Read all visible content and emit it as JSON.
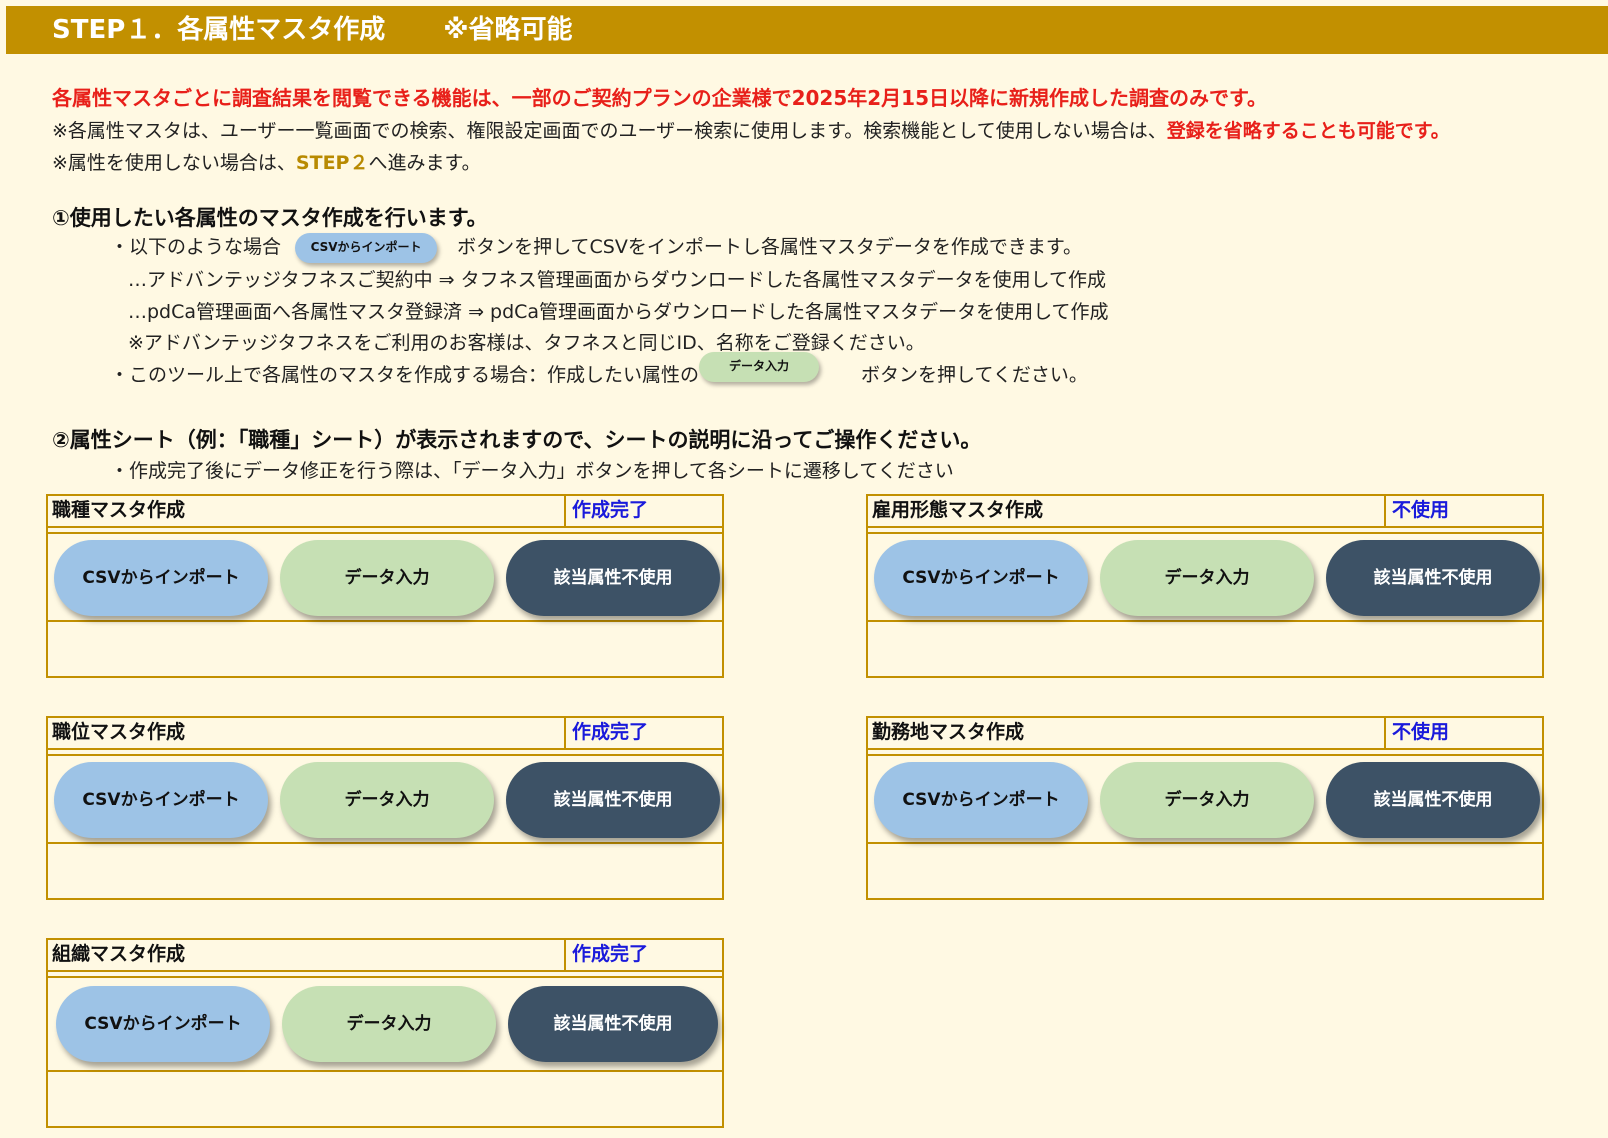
{
  "header": {
    "title": "STEP１．各属性マスタ作成",
    "note": "※省略可能"
  },
  "notice": {
    "warning": "各属性マスタごとに調査結果を閲覧できる機能は、一部のご契約プランの企業様で2025年2月15日以降に新規作成した調査のみです。",
    "line2_prefix": "※各属性マスタは、ユーザー一覧画面での検索、権限設定画面でのユーザー検索に使用します。検索機能として使用しない場合は、",
    "line2_red": "登録を省略することも可能です。",
    "line3_prefix": "※属性を使用しない場合は、",
    "line3_link": "STEP２",
    "line3_suffix": "へ進みます。"
  },
  "section1": {
    "heading": "①使用したい各属性のマスタ作成を行います。",
    "bullet1_prefix": "・以下のような場合",
    "bullet1_button": "CSVからインポート",
    "bullet1_suffix": "ボタンを押してCSVをインポートし各属性マスタデータを作成できます。",
    "sub1": "…アドバンテッジタフネスご契約中 ⇒ タフネス管理画面からダウンロードした各属性マスタデータを使用して作成",
    "sub2": "…pdCa管理画面へ各属性マスタ登録済 ⇒ pdCa管理画面からダウンロードした各属性マスタデータを使用して作成",
    "sub3": "※アドバンテッジタフネスをご利用のお客様は、タフネスと同じID、名称をご登録ください。",
    "bullet2_prefix": "・このツール上で各属性のマスタを作成する場合：作成したい属性の",
    "bullet2_button": "データ入力",
    "bullet2_suffix": "ボタンを押してください。"
  },
  "section2": {
    "heading": "②属性シート（例：「職種」シート）が表示されますので、シートの説明に沿ってご操作ください。",
    "bullet": "・作成完了後にデータ修正を行う際は、「データ入力」ボタンを押して各シートに遷移してください"
  },
  "buttons": {
    "csv": "CSVからインポート",
    "data": "データ入力",
    "unused": "該当属性不使用"
  },
  "panels": [
    {
      "title": "職種マスタ作成",
      "status": "作成完了"
    },
    {
      "title": "雇用形態マスタ作成",
      "status": "不使用"
    },
    {
      "title": "職位マスタ作成",
      "status": "作成完了"
    },
    {
      "title": "勤務地マスタ作成",
      "status": "不使用"
    },
    {
      "title": "組織マスタ作成",
      "status": "作成完了"
    }
  ],
  "colors": {
    "header_bg": "#c29000",
    "page_bg": "#fff9e3",
    "warning_red": "#e8201a",
    "status_blue": "#1a1adb",
    "btn_csv": "#9dc3e6",
    "btn_data": "#c6e0b4",
    "btn_unused": "#3d5266"
  }
}
